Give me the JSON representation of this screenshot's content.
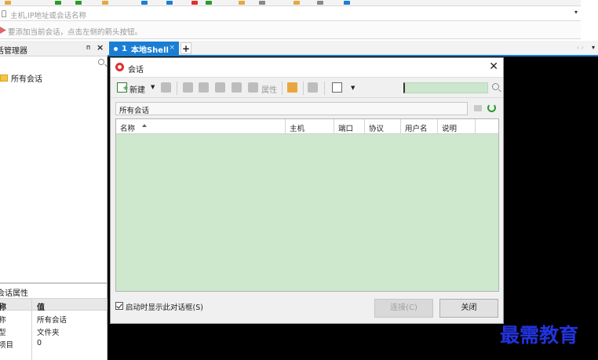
{
  "address_bar": {
    "placeholder": "主机,IP地址或会话名称"
  },
  "hint_bar": {
    "text": "要添加当前会话，点击左侧的箭头按钮。"
  },
  "session_manager": {
    "title": "话管理器",
    "pin_symbol": "ᴨ",
    "close_symbol": "×",
    "tree": [
      {
        "label": "所有会话"
      }
    ],
    "properties": {
      "title": "会话属性",
      "header": {
        "name": "称",
        "value": "值"
      },
      "rows": [
        {
          "name": "称",
          "value": "所有会话"
        },
        {
          "name": "型",
          "value": "文件夹"
        },
        {
          "name": "项目",
          "value": "0"
        }
      ]
    }
  },
  "tabs": {
    "active": {
      "number": "1",
      "label": "本地Shell"
    },
    "add_symbol": "+",
    "nav_symbol": "‹ ›",
    "more_symbol": "▾"
  },
  "dialog": {
    "title": "会话",
    "close_symbol": "✕",
    "toolbar": {
      "new_label": "新建",
      "properties_label": "属性"
    },
    "path": "所有会话",
    "columns": [
      "名称",
      "主机",
      "端口",
      "协议",
      "用户名",
      "说明"
    ],
    "startup_checkbox": {
      "label": "启动时显示此对话框(S)",
      "checked": true
    },
    "buttons": {
      "connect": "连接(C)",
      "close": "关闭"
    }
  },
  "watermark": "最需教育",
  "colors": {
    "accent_blue": "#1a7fd4",
    "grid_green": "#cde8cd",
    "terminal_black": "#000000",
    "watermark_blue": "#2233dd"
  }
}
